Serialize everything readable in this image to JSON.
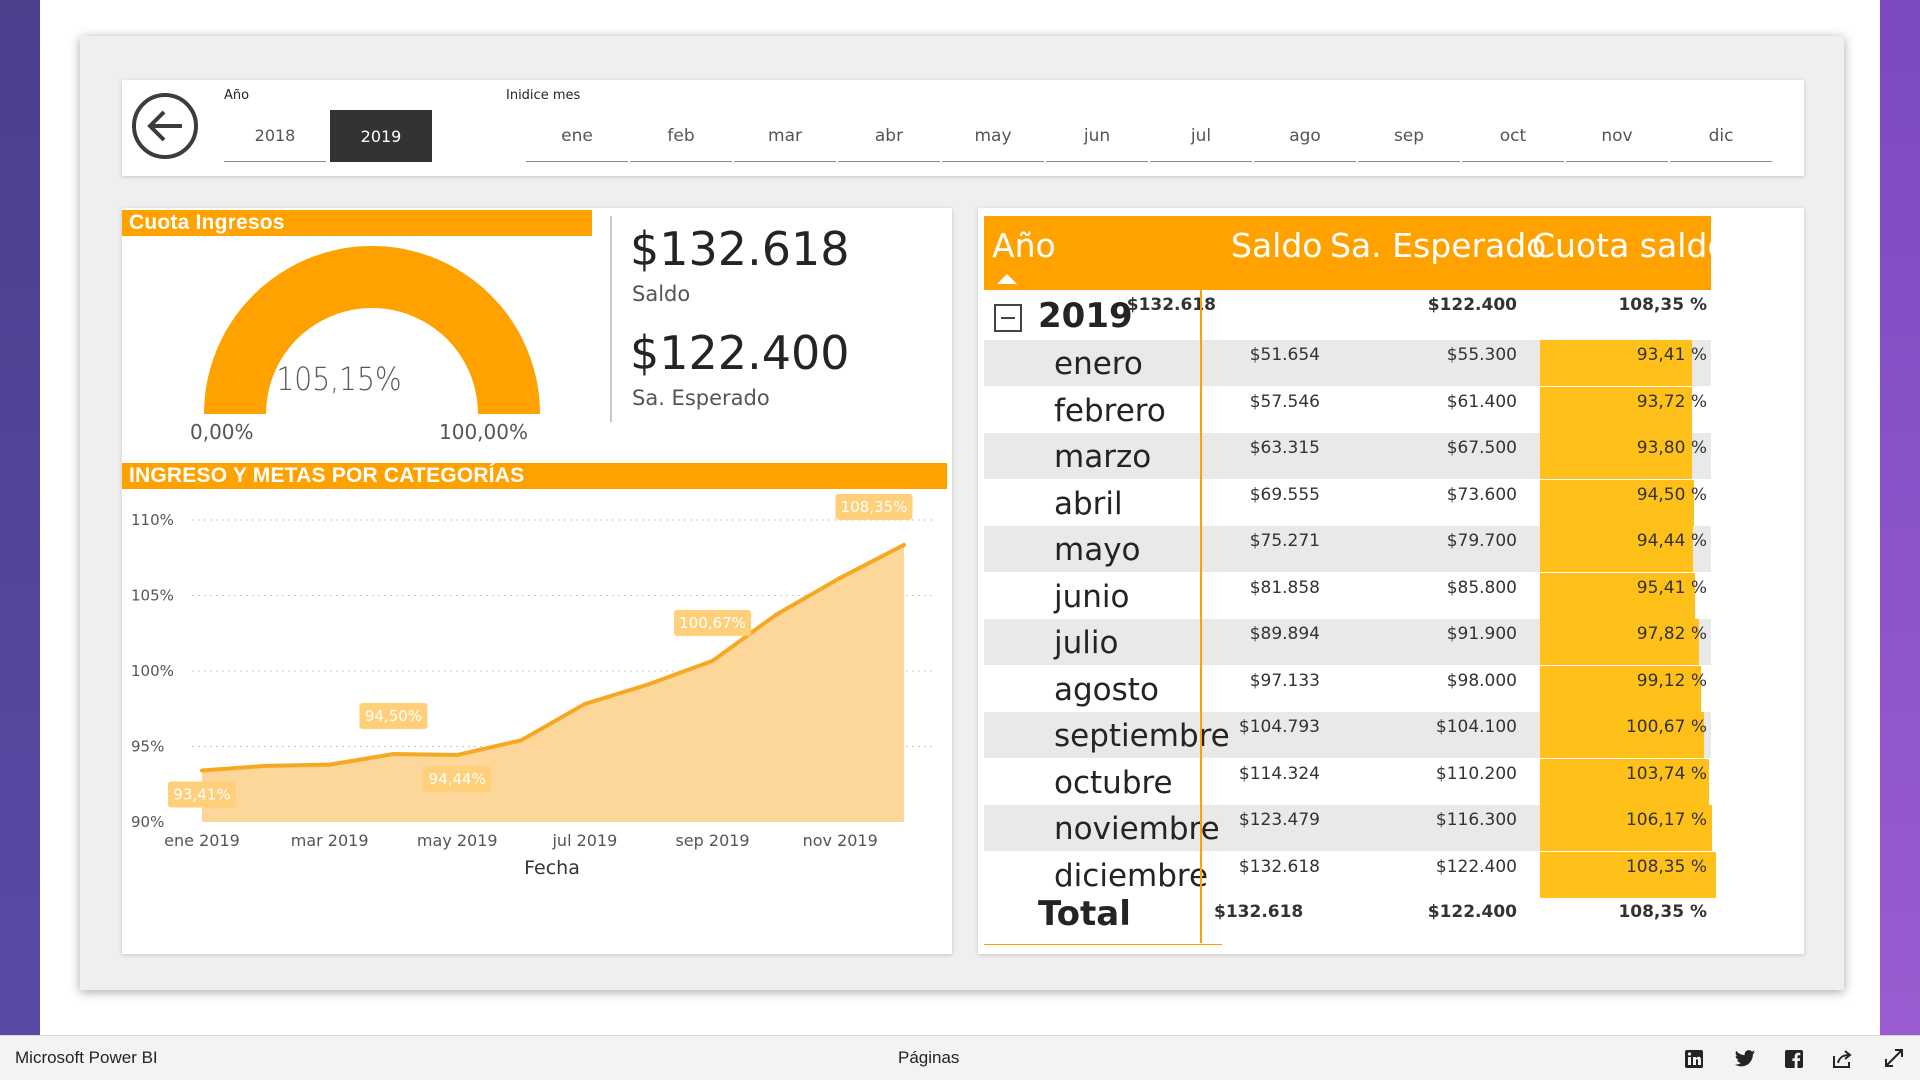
{
  "filters": {
    "year_title": "Año",
    "years": [
      "2018",
      "2019"
    ],
    "selected_year": "2019",
    "month_title": "Inidice mes",
    "months": [
      "ene",
      "feb",
      "mar",
      "abr",
      "may",
      "jun",
      "jul",
      "ago",
      "sep",
      "oct",
      "nov",
      "dic"
    ]
  },
  "gauge": {
    "title": "Cuota Ingresos",
    "value": "105,15%",
    "value_fraction": 1.0,
    "min": "0,00%",
    "max": "100,00%",
    "color": "#ffa200"
  },
  "kpis": {
    "saldo_value": "$132.618",
    "saldo_label": "Saldo",
    "esperado_value": "$122.400",
    "esperado_label": "Sa. Esperado"
  },
  "chart_data": {
    "type": "area",
    "title": "INGRESO Y METAS POR CATEGORÍAS",
    "xlabel": "Fecha",
    "ylabel": "",
    "x_tick_labels": [
      "ene 2019",
      "mar 2019",
      "may 2019",
      "jul 2019",
      "sep 2019",
      "nov 2019"
    ],
    "y_tick_labels": [
      "110%",
      "105%",
      "100%",
      "95%",
      "90%"
    ],
    "ylim": [
      90,
      110
    ],
    "x": [
      "ene 2019",
      "feb 2019",
      "mar 2019",
      "abr 2019",
      "may 2019",
      "jun 2019",
      "jul 2019",
      "ago 2019",
      "sep 2019",
      "oct 2019",
      "nov 2019",
      "dic 2019"
    ],
    "values": [
      93.41,
      93.72,
      93.8,
      94.5,
      94.44,
      95.41,
      97.82,
      99.12,
      100.67,
      103.74,
      106.17,
      108.35
    ],
    "data_labels": [
      {
        "index": 0,
        "text": "93,41%",
        "pos": "below"
      },
      {
        "index": 3,
        "text": "94,50%",
        "pos": "above"
      },
      {
        "index": 4,
        "text": "94,44%",
        "pos": "below"
      },
      {
        "index": 8,
        "text": "100,67%",
        "pos": "above"
      },
      {
        "index": 11,
        "text": "108,35%",
        "pos": "above"
      }
    ],
    "grid": true,
    "line_color": "#f7a823",
    "fill_color": "#fdd699"
  },
  "matrix": {
    "headers": [
      "Año",
      "Saldo",
      "Sa. Esperado",
      "Cuota saldo"
    ],
    "year_row": {
      "label": "2019",
      "saldo": "$132.618",
      "esperado": "$122.400",
      "cuota": "108,35 %"
    },
    "rows": [
      {
        "month": "enero",
        "saldo": "$51.654",
        "esperado": "$55.300",
        "cuota": "93,41 %",
        "pct": 93.41
      },
      {
        "month": "febrero",
        "saldo": "$57.546",
        "esperado": "$61.400",
        "cuota": "93,72 %",
        "pct": 93.72
      },
      {
        "month": "marzo",
        "saldo": "$63.315",
        "esperado": "$67.500",
        "cuota": "93,80 %",
        "pct": 93.8
      },
      {
        "month": "abril",
        "saldo": "$69.555",
        "esperado": "$73.600",
        "cuota": "94,50 %",
        "pct": 94.5
      },
      {
        "month": "mayo",
        "saldo": "$75.271",
        "esperado": "$79.700",
        "cuota": "94,44 %",
        "pct": 94.44
      },
      {
        "month": "junio",
        "saldo": "$81.858",
        "esperado": "$85.800",
        "cuota": "95,41 %",
        "pct": 95.41
      },
      {
        "month": "julio",
        "saldo": "$89.894",
        "esperado": "$91.900",
        "cuota": "97,82 %",
        "pct": 97.82
      },
      {
        "month": "agosto",
        "saldo": "$97.133",
        "esperado": "$98.000",
        "cuota": "99,12 %",
        "pct": 99.12
      },
      {
        "month": "septiembre",
        "saldo": "$104.793",
        "esperado": "$104.100",
        "cuota": "100,67 %",
        "pct": 100.67
      },
      {
        "month": "octubre",
        "saldo": "$114.324",
        "esperado": "$110.200",
        "cuota": "103,74 %",
        "pct": 103.74
      },
      {
        "month": "noviembre",
        "saldo": "$123.479",
        "esperado": "$116.300",
        "cuota": "106,17 %",
        "pct": 106.17
      },
      {
        "month": "diciembre",
        "saldo": "$132.618",
        "esperado": "$122.400",
        "cuota": "108,35 %",
        "pct": 108.35
      }
    ],
    "total_row": {
      "label": "Total",
      "saldo": "$132.618",
      "esperado": "$122.400",
      "cuota": "108,35 %"
    },
    "bar_color": "#ffc01a"
  },
  "footer": {
    "brand": "Microsoft Power BI",
    "pages_label": "Páginas",
    "icons": [
      "linkedin-icon",
      "twitter-icon",
      "facebook-icon",
      "share-icon",
      "fullscreen-icon"
    ]
  }
}
